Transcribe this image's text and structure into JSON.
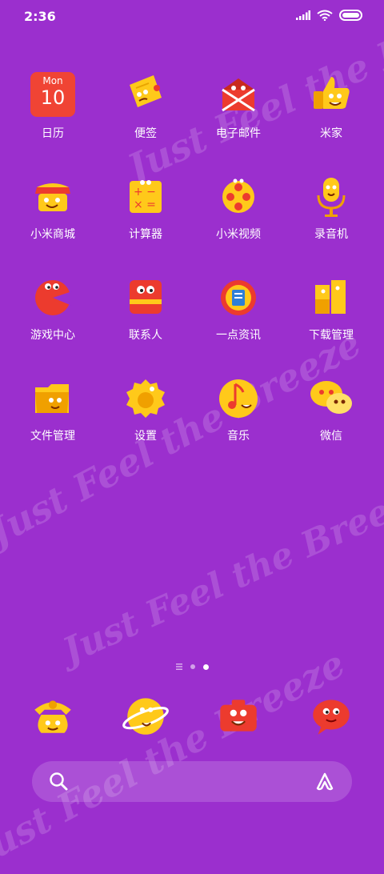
{
  "status_bar": {
    "time": "2:36",
    "icons": [
      "signal-icon",
      "wifi-icon",
      "battery-icon"
    ]
  },
  "apps": [
    {
      "label": "日历",
      "icon": "calendar-icon",
      "calendar_day": "Mon",
      "calendar_date": "10"
    },
    {
      "label": "便签",
      "icon": "notes-icon"
    },
    {
      "label": "电子邮件",
      "icon": "email-icon"
    },
    {
      "label": "米家",
      "icon": "mijia-icon"
    },
    {
      "label": "小米商城",
      "icon": "mi-store-icon"
    },
    {
      "label": "计算器",
      "icon": "calculator-icon"
    },
    {
      "label": "小米视频",
      "icon": "mi-video-icon"
    },
    {
      "label": "录音机",
      "icon": "recorder-icon"
    },
    {
      "label": "游戏中心",
      "icon": "game-center-icon"
    },
    {
      "label": "联系人",
      "icon": "contacts-icon"
    },
    {
      "label": "一点资讯",
      "icon": "news-icon"
    },
    {
      "label": "下载管理",
      "icon": "download-manager-icon"
    },
    {
      "label": "文件管理",
      "icon": "file-manager-icon"
    },
    {
      "label": "设置",
      "icon": "settings-icon"
    },
    {
      "label": "音乐",
      "icon": "music-icon"
    },
    {
      "label": "微信",
      "icon": "wechat-icon"
    }
  ],
  "page_indicator": {
    "pages": 3,
    "current": 3
  },
  "dock": [
    {
      "icon": "phone-icon"
    },
    {
      "icon": "browser-icon"
    },
    {
      "icon": "camera-icon"
    },
    {
      "icon": "messages-icon"
    }
  ],
  "wallpaper": {
    "text": "Just Feel the Breeze"
  },
  "colors": {
    "background": "#9b2fce",
    "icon_yellow": "#ffc91a",
    "icon_red": "#ec3b2e",
    "calendar_red": "#f04434"
  }
}
